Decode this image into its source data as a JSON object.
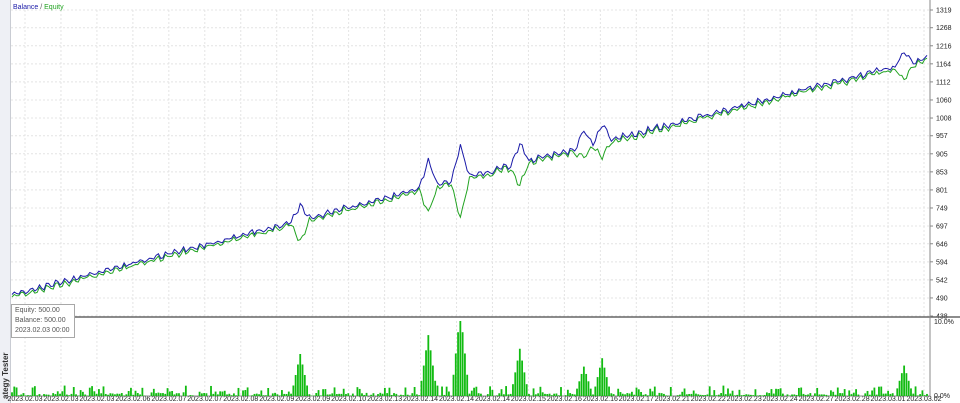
{
  "side_panel": {
    "label": "ategy Tester"
  },
  "legend": {
    "balance": "Balance",
    "separator": " / ",
    "equity": "Equity"
  },
  "colors": {
    "balance": "#1a1aa8",
    "equity": "#21a321",
    "grid": "#e4e4e4",
    "volume": "#11bb11"
  },
  "tooltip": {
    "equity": "Equity: 500.00",
    "balance": "Balance: 500.00",
    "time": "2023.02.03 00:00"
  },
  "chart_data": {
    "type": "line",
    "y_ticks": [
      "1319",
      "1268",
      "1216",
      "1164",
      "1112",
      "1060",
      "1008",
      "957",
      "905",
      "853",
      "801",
      "749",
      "697",
      "646",
      "594",
      "542",
      "490",
      "438"
    ],
    "y_range": [
      438,
      1319
    ],
    "volume_ticks": [
      "10.0%",
      "0.0%"
    ],
    "x_ticks": [
      "2023.02.03",
      "2023.02.03",
      "2023.02.03",
      "2023.02.06",
      "2023.02.07",
      "2023.02.07",
      "2023.02.08",
      "2023.02.09",
      "2023.02.09",
      "2023.02.10",
      "2023.02.13",
      "2023.02.14",
      "2023.02.14",
      "2023.02.14",
      "2023.02.15",
      "2023.02.16",
      "2023.02.16",
      "2023.02.17",
      "2023.02.21",
      "2023.02.22",
      "2023.02.23",
      "2023.02.24",
      "2023.02.27",
      "2023.02.28",
      "2023.03.01",
      "2023.03.02"
    ],
    "grid": true,
    "series": [
      {
        "name": "Balance",
        "start": 500,
        "end": 1180
      },
      {
        "name": "Equity",
        "start": 500,
        "end": 1175
      }
    ],
    "spikes": [
      {
        "pos": 0.315,
        "up": 1.6,
        "down": 2.4
      },
      {
        "pos": 0.455,
        "up": 3.2,
        "down": 2.6
      },
      {
        "pos": 0.49,
        "up": 3.8,
        "down": 4.3
      },
      {
        "pos": 0.555,
        "up": 2.3,
        "down": 2.2
      },
      {
        "pos": 0.625,
        "up": 1.8,
        "down": 1.0
      },
      {
        "pos": 0.645,
        "up": 2.0,
        "down": 1.6
      },
      {
        "pos": 0.975,
        "up": 1.4,
        "down": 1.5
      }
    ]
  }
}
